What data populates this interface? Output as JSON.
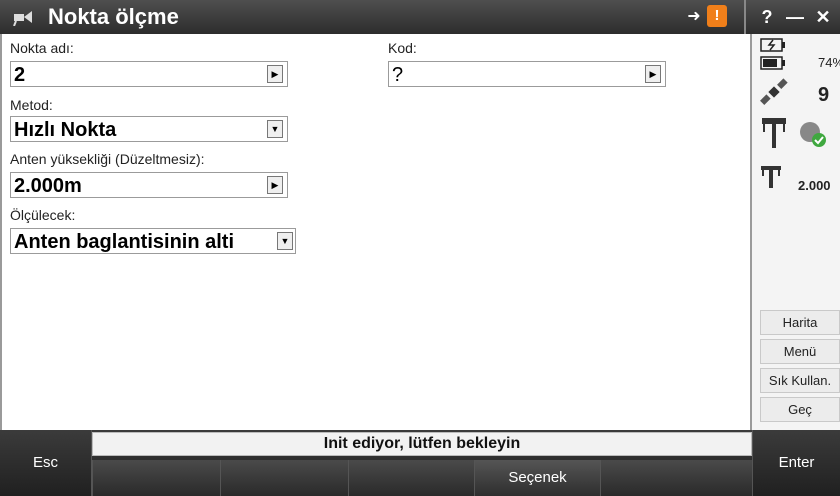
{
  "window": {
    "title": "Nokta ölçme",
    "help_label": "?",
    "minimize_label": "—",
    "close_label": "✕",
    "warn_label": "!",
    "login_icon": "login-arrow-icon"
  },
  "form": {
    "point_name": {
      "label": "Nokta adı:",
      "value": "2"
    },
    "code": {
      "label": "Kod:",
      "value": "?"
    },
    "method": {
      "label": "Metod:",
      "value": "Hızlı Nokta"
    },
    "antenna_height": {
      "label": "Anten yüksekliği (Düzeltmesiz):",
      "value": "2.000m"
    },
    "measured_to": {
      "label": "Ölçülecek:",
      "value": "Anten baglantisinin alti"
    }
  },
  "sidebar": {
    "battery_percent": "74%",
    "satellites": "9",
    "antenna_height": "2.000",
    "buttons": [
      "Harita",
      "Menü",
      "Sık Kullan.",
      "Geç"
    ]
  },
  "footer": {
    "status_message": "Init ediyor, lütfen bekleyin",
    "esc_label": "Esc",
    "options_label": "Seçenek",
    "enter_label": "Enter"
  },
  "colors": {
    "warning": "#f07f1a",
    "titlebar": "#3a3a3a"
  }
}
